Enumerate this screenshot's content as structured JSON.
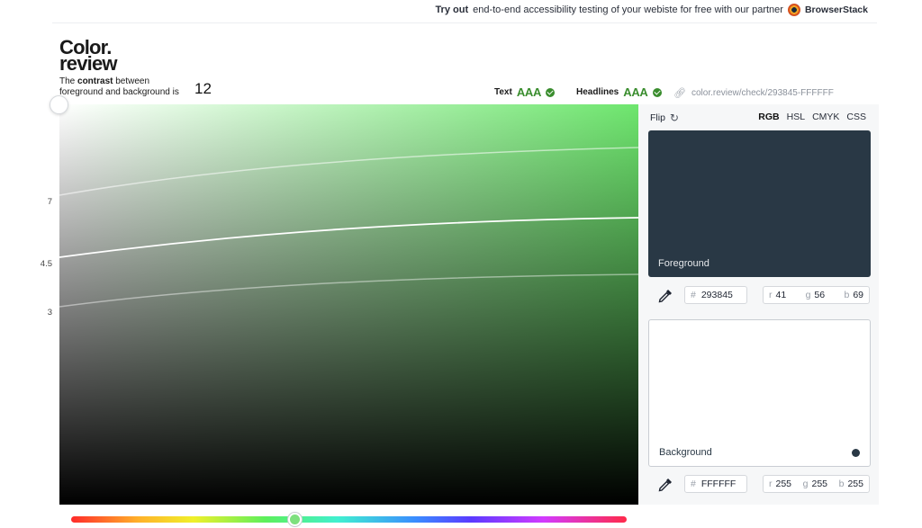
{
  "promo": {
    "lead": "Try out",
    "text": "end-to-end accessibility testing of your webiste for free with our partner",
    "partner": "BrowserStack"
  },
  "logo": {
    "line1": "Color.",
    "line2": "review"
  },
  "contrast": {
    "prefix": "The",
    "bold": "contrast",
    "suffix": "between",
    "line2": "foreground and background is",
    "ratio": "12"
  },
  "wcag": {
    "text_label": "Text",
    "text_value": "AAA",
    "headlines_label": "Headlines",
    "headlines_value": "AAA"
  },
  "permalink": "color.review/check/293845-FFFFFF",
  "scale_labels": [
    "7",
    "4.5",
    "3"
  ],
  "controls": {
    "flip_label": "Flip",
    "modes": [
      "RGB",
      "HSL",
      "CMYK",
      "CSS"
    ],
    "active_mode": "RGB"
  },
  "foreground": {
    "label": "Foreground",
    "hex": "293845",
    "r": "41",
    "g": "56",
    "b": "69",
    "color": "#293845"
  },
  "background": {
    "label": "Background",
    "hex": "FFFFFF",
    "r": "255",
    "g": "255",
    "b": "255",
    "color": "#FFFFFF"
  },
  "accent_color": "#3a8d2e",
  "icons": {
    "partner": "browserstack-logo-icon",
    "check": "check-circle-icon",
    "link": "link-icon",
    "flip": "refresh-icon",
    "dropper": "eyedropper-icon"
  }
}
